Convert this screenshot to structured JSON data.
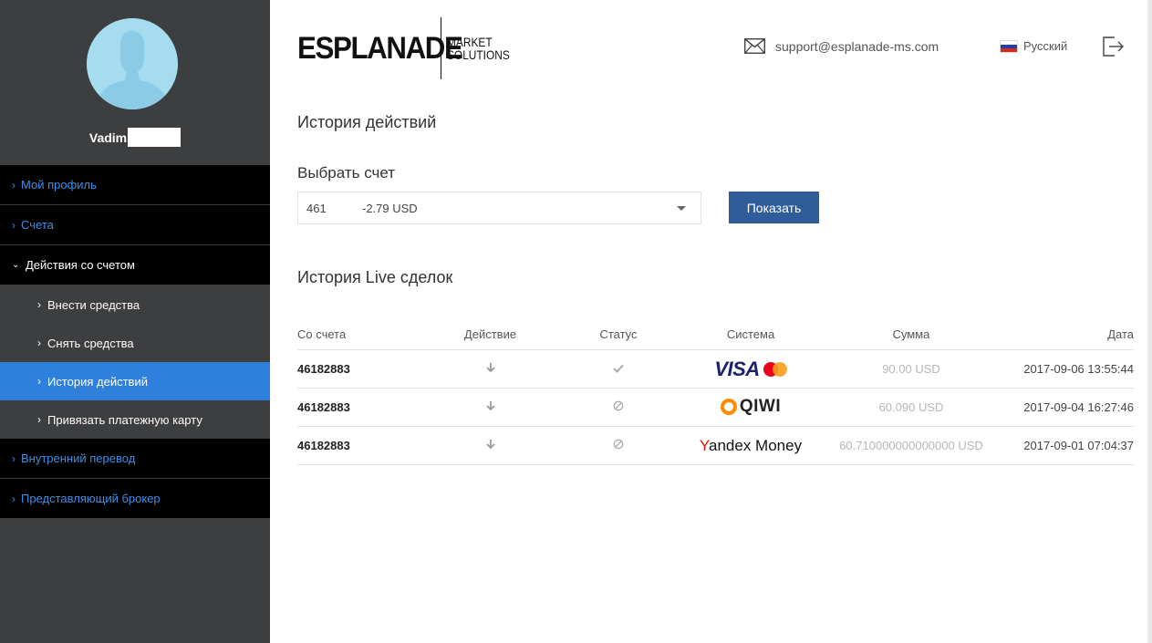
{
  "user": {
    "name": "Vadim"
  },
  "sidebar": {
    "items": [
      {
        "label": "Мой профиль"
      },
      {
        "label": "Счета"
      },
      {
        "label": "Действия со счетом"
      },
      {
        "label": "Внутренний перевод"
      },
      {
        "label": "Представляющий брокер"
      }
    ],
    "subitems": [
      {
        "label": "Внести средства"
      },
      {
        "label": "Снять средства"
      },
      {
        "label": "История действий"
      },
      {
        "label": "Привязать платежную карту"
      }
    ]
  },
  "header": {
    "logo_main": "ESPLANADE",
    "logo_sub_1": "MARKET",
    "logo_sub_2": "SOLUTIONS",
    "support_email": "support@esplanade-ms.com",
    "language": "Русский"
  },
  "main": {
    "title": "История действий",
    "select_label": "Выбрать счет",
    "select_account": "461",
    "select_balance": "-2.79 USD",
    "show_button": "Показать",
    "section_title": "История Live сделок"
  },
  "table": {
    "headers": [
      "Со счета",
      "Действие",
      "Статус",
      "Система",
      "Сумма",
      "Дата"
    ],
    "rows": [
      {
        "account": "46182883",
        "system_text": "VISA",
        "amount": "90.00 USD",
        "date": "2017-09-06 13:55:44"
      },
      {
        "account": "46182883",
        "system_text": "QIWI",
        "amount": "60.090 USD",
        "date": "2017-09-04 16:27:46"
      },
      {
        "account": "46182883",
        "system_text_1": "Y",
        "system_text_2": "andex",
        "system_text_3": " Money",
        "amount": "60.710000000000000 USD",
        "date": "2017-09-01 07:04:37"
      }
    ]
  },
  "colors": {
    "sidebar_bg": "#3d3e40",
    "menu_bg": "#000000",
    "menu_link": "#3b8ee8",
    "active_item": "#2f7fdc",
    "button": "#2f5d9a"
  }
}
